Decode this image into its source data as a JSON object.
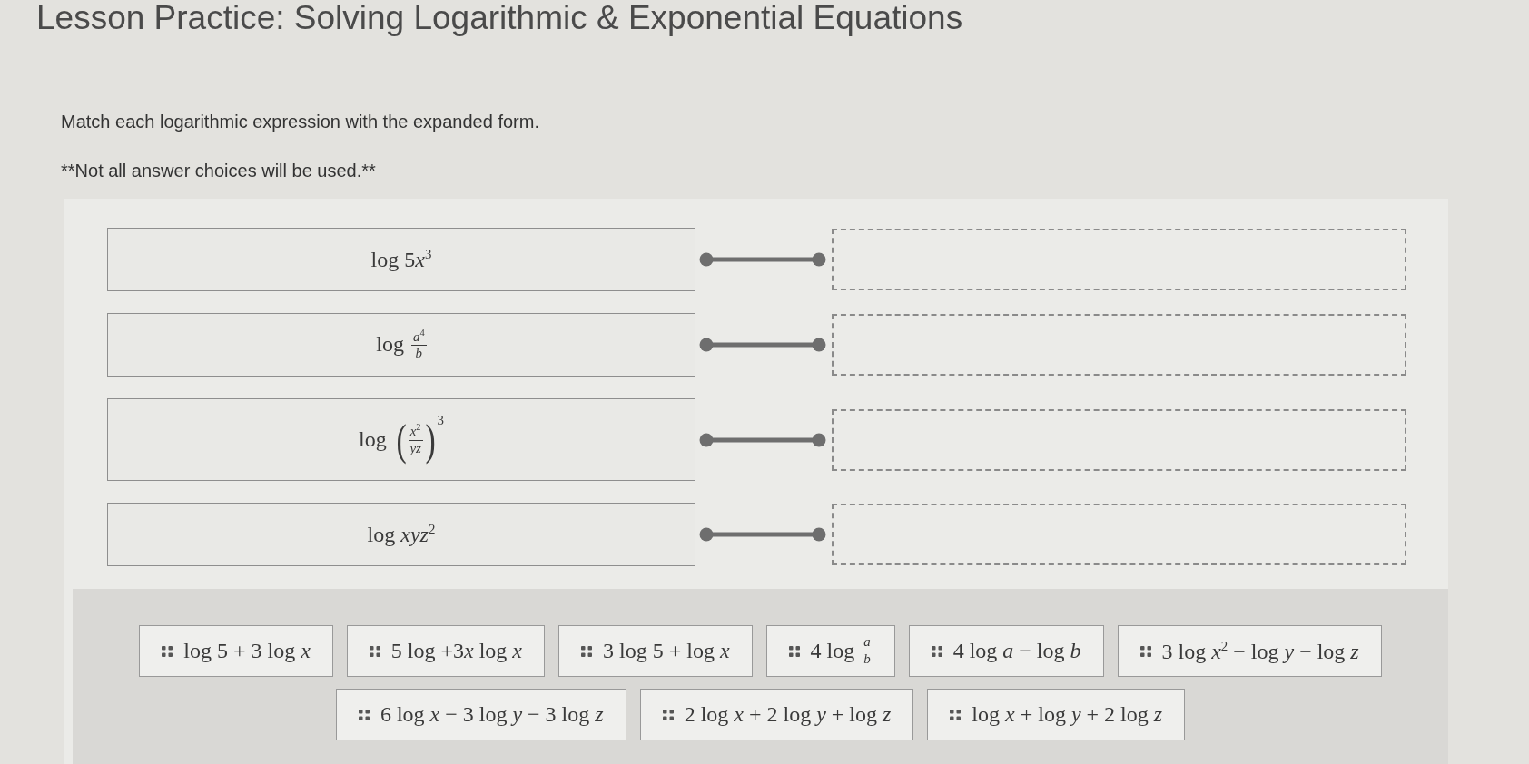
{
  "page": {
    "title": "Lesson Practice: Solving Logarithmic & Exponential Equations"
  },
  "instructions": "Match each logarithmic expression with the expanded form.",
  "note": "**Not all answer choices will be used.**",
  "prompts": [
    {
      "math": [
        {
          "kind": "text",
          "text": "log 5"
        },
        {
          "kind": "text",
          "text": "*x*$^{3}$"
        }
      ]
    },
    {
      "math": [
        {
          "kind": "text",
          "text": "log"
        },
        {
          "kind": "frac",
          "num": "*a*$^{4}$",
          "den": "*b*"
        }
      ]
    },
    {
      "math": [
        {
          "kind": "text",
          "text": "log"
        },
        {
          "kind": "paren",
          "open": "(",
          "num": "*x*$^{2}$",
          "den": "*yz*",
          "close": ")",
          "power": "3"
        }
      ]
    },
    {
      "math": [
        {
          "kind": "text",
          "text": "log *xyz*$^{2}$"
        }
      ]
    }
  ],
  "choices": [
    {
      "math": [
        {
          "kind": "text",
          "text": "log 5 + 3 log *x*"
        }
      ]
    },
    {
      "math": [
        {
          "kind": "text",
          "text": "5 log +3"
        },
        {
          "kind": "text",
          "text": "*x* log *x*"
        }
      ]
    },
    {
      "math": [
        {
          "kind": "text",
          "text": "3 log 5 + log *x*"
        }
      ]
    },
    {
      "math": [
        {
          "kind": "text",
          "text": "4 log"
        },
        {
          "kind": "frac",
          "num": "*a*",
          "den": "*b*"
        }
      ]
    },
    {
      "math": [
        {
          "kind": "text",
          "text": "4 log *a* − log *b*"
        }
      ]
    },
    {
      "math": [
        {
          "kind": "text",
          "text": "3 log *x*$^{2}$ − log *y* − log *z*"
        }
      ]
    },
    {
      "math": [
        {
          "kind": "text",
          "text": "6 log *x* − 3 log *y* − 3 log *z*"
        }
      ]
    },
    {
      "math": [
        {
          "kind": "text",
          "text": "2 log *x* + 2 log *y* + log *z*"
        }
      ]
    },
    {
      "math": [
        {
          "kind": "text",
          "text": "log *x* + log *y* + 2 log *z*"
        }
      ]
    }
  ]
}
